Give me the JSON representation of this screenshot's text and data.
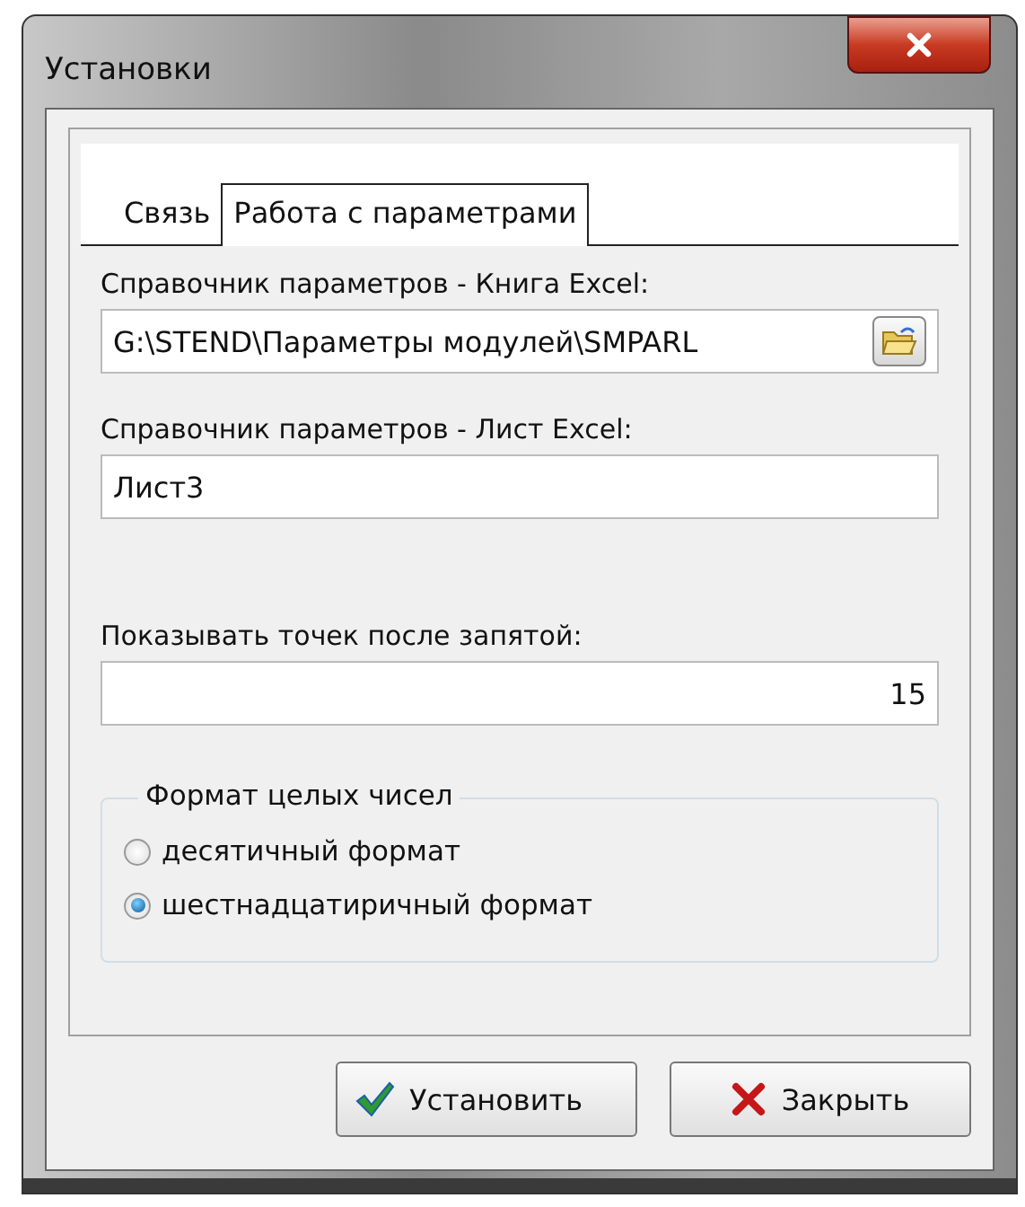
{
  "window": {
    "title": "Установки"
  },
  "tabs": [
    {
      "label": "Связь",
      "selected": false
    },
    {
      "label": "Работа с параметрами",
      "selected": true
    }
  ],
  "fields": [
    {
      "label": "Справочник параметров - Книга Excel:",
      "value": "G:\\STEND\\Параметры модулей\\SMPARL",
      "kind": "browse"
    },
    {
      "label": "Справочник параметров - Лист Excel:",
      "value": "Лист3",
      "kind": "text"
    },
    {
      "label": "Показывать точек после запятой:",
      "value": "15",
      "kind": "number"
    }
  ],
  "group": {
    "title": "Формат целых чисел",
    "options": [
      {
        "label": "десятичный формат",
        "selected": false
      },
      {
        "label": "шестнадцатиричный формат",
        "selected": true
      }
    ]
  },
  "buttons": [
    {
      "label": "Установить",
      "kind": "ok"
    },
    {
      "label": "Закрыть",
      "kind": "close"
    }
  ]
}
